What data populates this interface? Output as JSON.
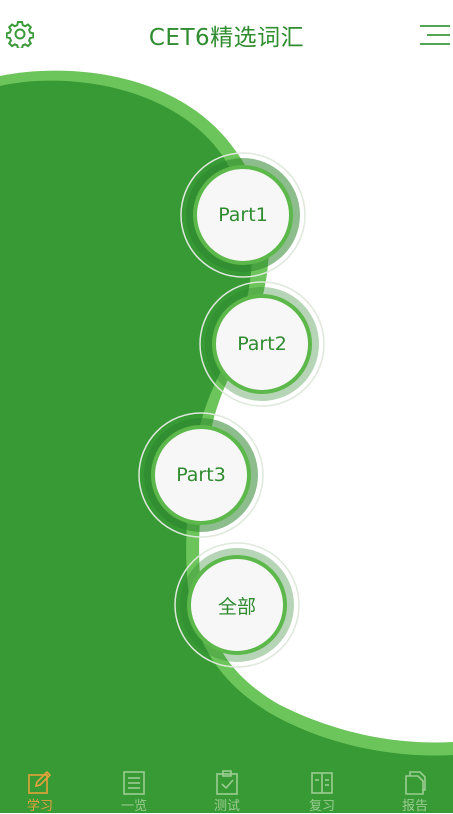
{
  "header": {
    "title": "CET6精选词汇",
    "left_icon": "gear-icon",
    "right_icon": "menu-icon"
  },
  "parts": [
    {
      "label": "Part1"
    },
    {
      "label": "Part2"
    },
    {
      "label": "Part3"
    },
    {
      "label": "全部"
    }
  ],
  "tabs": [
    {
      "label": "学习",
      "icon": "edit-icon",
      "active": true
    },
    {
      "label": "一览",
      "icon": "list-icon",
      "active": false
    },
    {
      "label": "测试",
      "icon": "clipboard-check-icon",
      "active": false
    },
    {
      "label": "复习",
      "icon": "book-icon",
      "active": false
    },
    {
      "label": "报告",
      "icon": "document-icon",
      "active": false
    }
  ],
  "colors": {
    "primary_green": "#3a9a3a",
    "light_green": "#6cc55a",
    "title_green": "#2f8c2f",
    "active_tab": "#e8a23a",
    "inactive_tab": "#9ccc92",
    "node_fill": "#f7f7f7"
  }
}
